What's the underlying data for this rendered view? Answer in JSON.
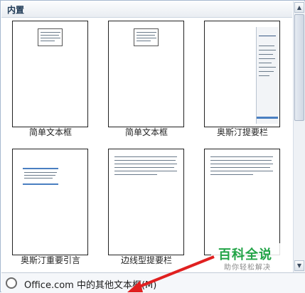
{
  "header": {
    "title": "内置"
  },
  "items": [
    {
      "label": "简单文本框"
    },
    {
      "label": "简单文本框"
    },
    {
      "label": "奥斯汀提要栏"
    },
    {
      "label": "奥斯汀重要引言"
    },
    {
      "label": "边线型提要栏"
    },
    {
      "label": ""
    }
  ],
  "footer": {
    "label": "Office.com 中的其他文本框(M)"
  },
  "watermark": {
    "title": "百科全说",
    "subtitle": "助你轻松解决"
  },
  "colors": {
    "accent": "#4a7fc1",
    "watermark": "#22a447",
    "arrow": "#e02020"
  },
  "icons": {
    "scroll_up": "chevron-up-icon",
    "scroll_down": "chevron-down-icon",
    "footer": "office-globe-icon"
  }
}
